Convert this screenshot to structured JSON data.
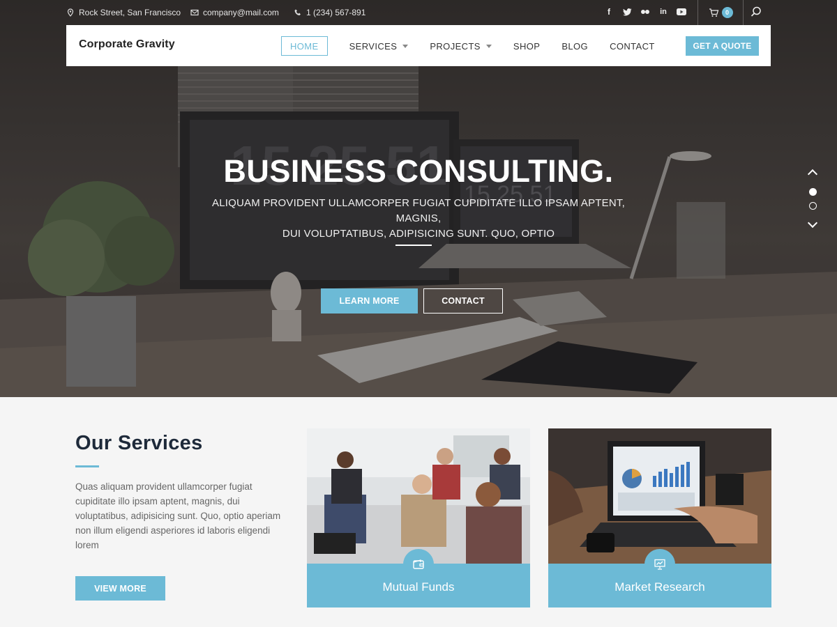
{
  "topbar": {
    "address": "Rock Street, San Francisco",
    "email": "company@mail.com",
    "phone": "1 (234) 567-891",
    "social_icons": [
      "facebook-icon",
      "twitter-icon",
      "flickr-icon",
      "linkedin-icon",
      "youtube-icon"
    ],
    "cart_count": "0"
  },
  "nav": {
    "logo": "Corporate Gravity",
    "items": [
      {
        "label": "HOME",
        "active": true,
        "has_caret": false
      },
      {
        "label": "SERVICES",
        "active": false,
        "has_caret": true
      },
      {
        "label": "PROJECTS",
        "active": false,
        "has_caret": true
      },
      {
        "label": "SHOP",
        "active": false,
        "has_caret": false
      },
      {
        "label": "BLOG",
        "active": false,
        "has_caret": false
      },
      {
        "label": "CONTACT",
        "active": false,
        "has_caret": false
      }
    ],
    "cta": "GET A QUOTE"
  },
  "hero": {
    "title": "BUSINESS CONSULTING.",
    "subtitle_line1": "ALIQUAM PROVIDENT ULLAMCORPER FUGIAT CUPIDITATE ILLO IPSAM APTENT, MAGNIS,",
    "subtitle_line2": "DUI VOLUPTATIBUS, ADIPISICING SUNT. QUO, OPTIO",
    "primary_button": "LEARN MORE",
    "secondary_button": "CONTACT"
  },
  "services": {
    "title": "Our Services",
    "text": "Quas aliquam provident ullamcorper fugiat cupiditate illo ipsam aptent, magnis, dui voluptatibus, adipisicing sunt. Quo, optio aperiam non illum eligendi asperiores id laboris eligendi lorem",
    "button": "VIEW MORE",
    "cards": [
      {
        "label": "Mutual Funds",
        "icon": "wallet-icon"
      },
      {
        "label": "Market Research",
        "icon": "presentation-chart-icon"
      }
    ]
  },
  "colors": {
    "accent": "#6cbad6",
    "heading": "#1e2a3a"
  }
}
